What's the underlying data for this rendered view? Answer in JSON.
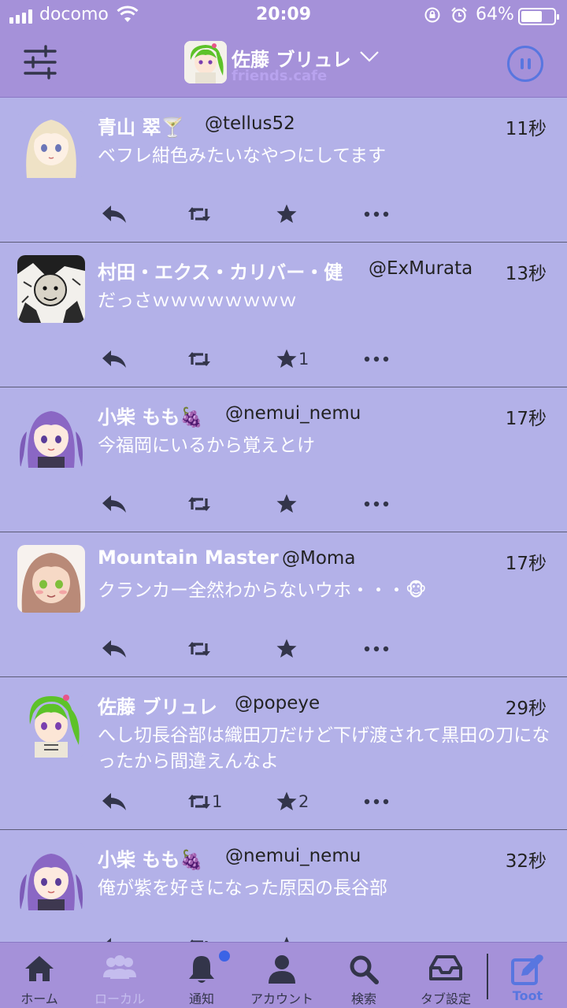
{
  "status_bar": {
    "carrier": "docomo",
    "time": "20:09",
    "battery_percent": "64%",
    "battery_level": 0.64
  },
  "header": {
    "account_name": "佐藤 ブリュレ",
    "account_domain": "friends.cafe",
    "icons": [
      "settings-sliders-icon",
      "chevron-down-icon",
      "pause-icon"
    ],
    "accent_color": "#5876e0"
  },
  "timeline": {
    "posts": [
      {
        "display_name": "青山 翠🍸",
        "handle": "@tellus52",
        "time": "11秒",
        "content": "ベフレ紺色みたいなやつにしてます",
        "boosts": "",
        "favs": ""
      },
      {
        "display_name": "村田・エクス・カリバー・健",
        "handle": "@ExMurata",
        "time": "13秒",
        "content": "だっさｗｗｗｗｗｗｗｗ",
        "boosts": "",
        "favs": "1"
      },
      {
        "display_name": "小柴 もも🍇",
        "handle": "@nemui_nemu",
        "time": "17秒",
        "content": "今福岡にいるから覚えとけ",
        "boosts": "",
        "favs": ""
      },
      {
        "display_name": "Mountain Master",
        "handle": "@Moma",
        "time": "17秒",
        "content": "クランカー全然わからないウホ・・・🐵",
        "boosts": "",
        "favs": ""
      },
      {
        "display_name": "佐藤 ブリュレ",
        "handle": "@popeye",
        "time": "29秒",
        "content": "へし切長谷部は織田刀だけど下げ渡されて黒田の刀になったから間違えんなよ",
        "boosts": "1",
        "favs": "2"
      },
      {
        "display_name": "小柴 もも🍇",
        "handle": "@nemui_nemu",
        "time": "32秒",
        "content": "俺が紫を好きになった原因の長谷部",
        "boosts": "",
        "favs": ""
      }
    ],
    "action_icons": [
      "reply-icon",
      "boost-icon",
      "favourite-star-icon",
      "more-dots-icon"
    ]
  },
  "tab_bar": {
    "tabs": [
      {
        "label": "ホーム",
        "icon": "home-icon"
      },
      {
        "label": "ローカル",
        "icon": "local-users-icon"
      },
      {
        "label": "通知",
        "icon": "bell-icon"
      },
      {
        "label": "アカウント",
        "icon": "person-icon"
      },
      {
        "label": "検索",
        "icon": "search-icon"
      },
      {
        "label": "タブ設定",
        "icon": "inbox-tray-icon"
      },
      {
        "label": "Toot",
        "icon": "compose-icon"
      }
    ]
  },
  "colors": {
    "background": "#b3b1e8",
    "bar": "#a591d9",
    "accent": "#5876e0",
    "icon_dark": "#33354a"
  }
}
